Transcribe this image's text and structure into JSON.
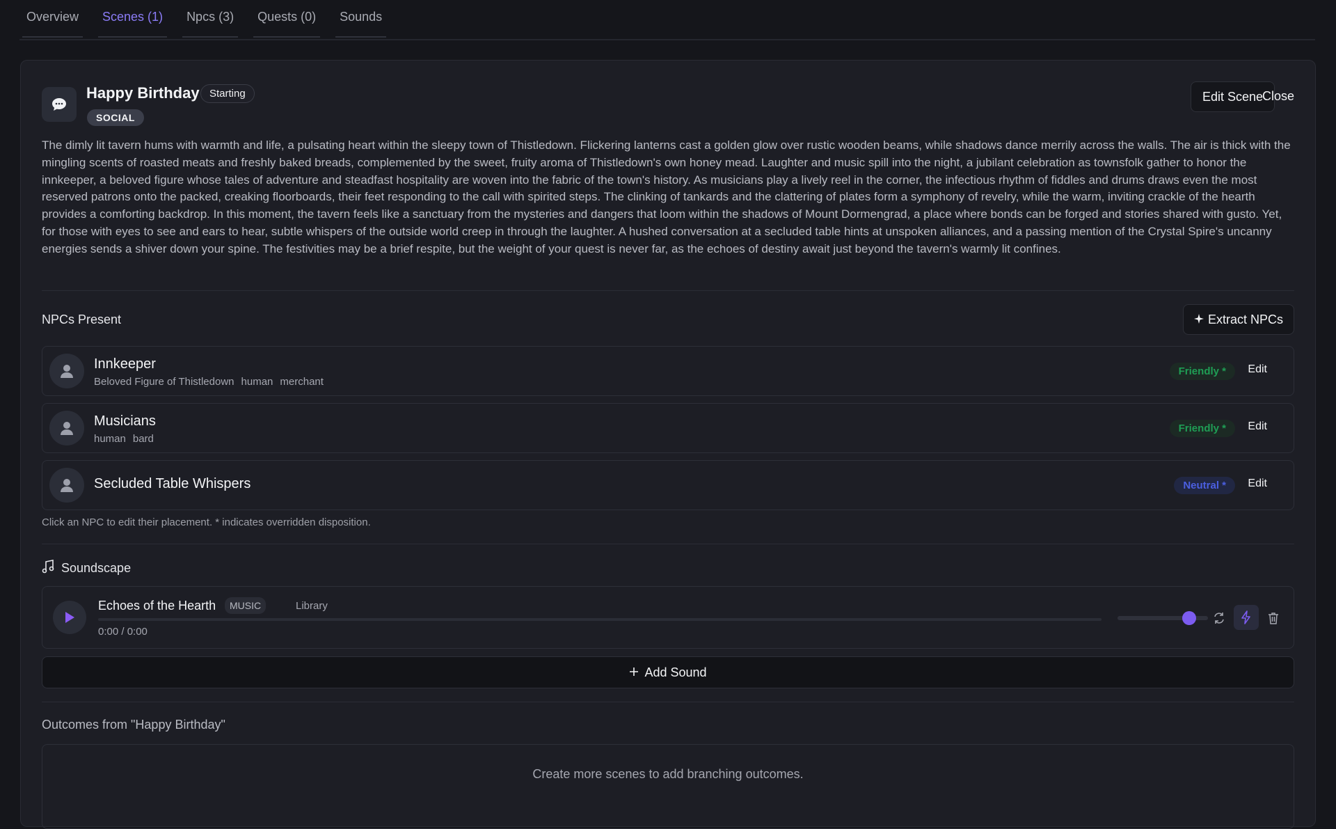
{
  "tabs": [
    {
      "label": "Overview",
      "active": false
    },
    {
      "label": "Scenes (1)",
      "active": true
    },
    {
      "label": "Npcs (3)",
      "active": false
    },
    {
      "label": "Quests (0)",
      "active": false
    },
    {
      "label": "Sounds",
      "active": false
    }
  ],
  "scene": {
    "title": "Happy Birthday",
    "starting_badge": "Starting",
    "type_badge": "SOCIAL",
    "edit_label": "Edit Scene",
    "close_label": "Close",
    "description": "The dimly lit tavern hums with warmth and life, a pulsating heart within the sleepy town of Thistledown. Flickering lanterns cast a golden glow over rustic wooden beams, while shadows dance merrily across the walls. The air is thick with the mingling scents of roasted meats and freshly baked breads, complemented by the sweet, fruity aroma of Thistledown's own honey mead. Laughter and music spill into the night, a jubilant celebration as townsfolk gather to honor the innkeeper, a beloved figure whose tales of adventure and steadfast hospitality are woven into the fabric of the town's history. As musicians play a lively reel in the corner, the infectious rhythm of fiddles and drums draws even the most reserved patrons onto the packed, creaking floorboards, their feet responding to the call with spirited steps. The clinking of tankards and the clattering of plates form a symphony of revelry, while the warm, inviting crackle of the hearth provides a comforting backdrop. In this moment, the tavern feels like a sanctuary from the mysteries and dangers that loom within the shadows of Mount Dormengrad, a place where bonds can be forged and stories shared with gusto. Yet, for those with eyes to see and ears to hear, subtle whispers of the outside world creep in through the laughter. A hushed conversation at a secluded table hints at unspoken alliances, and a passing mention of the Crystal Spire's uncanny energies sends a shiver down your spine. The festivities may be a brief respite, but the weight of your quest is never far, as the echoes of destiny await just beyond the tavern's warmly lit confines."
  },
  "npcs_section": {
    "title": "NPCs Present",
    "extract_label": "Extract NPCs",
    "hint": "Click an NPC to edit their placement. * indicates overridden disposition.",
    "items": [
      {
        "name": "Innkeeper",
        "tags": [
          "Beloved Figure of Thistledown",
          "human",
          "merchant"
        ],
        "disposition": "Friendly *",
        "edit_label": "Edit"
      },
      {
        "name": "Musicians",
        "tags": [
          "human",
          "bard"
        ],
        "disposition": "Friendly *",
        "edit_label": "Edit"
      },
      {
        "name": "Secluded Table Whispers",
        "tags": [],
        "disposition": "Neutral *",
        "edit_label": "Edit"
      }
    ]
  },
  "soundscape": {
    "title": "Soundscape",
    "sound": {
      "title": "Echoes of the Hearth",
      "type": "MUSIC",
      "source": "Library",
      "time": "0:00 / 0:00",
      "progress": 0,
      "volume": 0.75
    },
    "add_label": "Add Sound"
  },
  "outcomes": {
    "title": "Outcomes from \"Happy Birthday\"",
    "empty_text": "Create more scenes to add branching outcomes."
  },
  "colors": {
    "accent": "#8b7cf6",
    "friendly": "#1f9e55",
    "neutral": "#4b5fe0",
    "background": "#15161b"
  }
}
